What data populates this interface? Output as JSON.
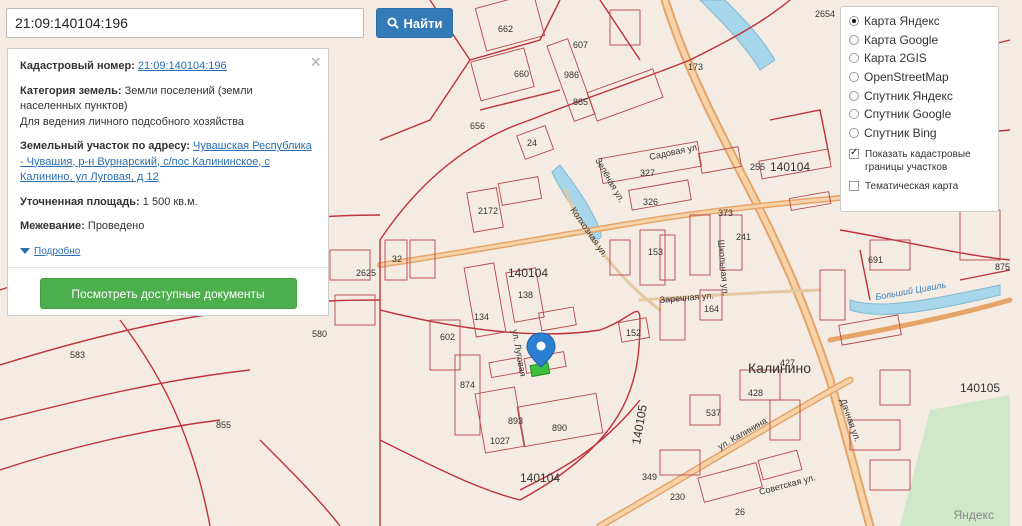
{
  "search": {
    "value": "21:09:140104:196",
    "button_label": "Найти"
  },
  "info": {
    "cadastral_label": "Кадастровый номер:",
    "cadastral_value": "21:09:140104:196",
    "category_label": "Категория земель:",
    "category_value": "Земли поселений (земли населенных пунктов)",
    "category_use": "Для ведения личного подсобного хозяйства",
    "address_label": "Земельный участок по адресу:",
    "address_value": "Чувашская Республика - Чувашия, р-н Вурнарский, с/пос Калининское, с Калинино, ул Луговая, д 12",
    "area_label": "Уточненная площадь:",
    "area_value": "1 500 кв.м.",
    "survey_label": "Межевание:",
    "survey_value": "Проведено",
    "details_label": "Подробно",
    "docs_button": "Посмотреть доступные документы",
    "close_glyph": "×"
  },
  "layers": {
    "options": [
      {
        "label": "Карта Яндекс",
        "selected": true
      },
      {
        "label": "Карта Google",
        "selected": false
      },
      {
        "label": "Карта 2GIS",
        "selected": false
      },
      {
        "label": "OpenStreetMap",
        "selected": false
      },
      {
        "label": "Спутник Яндекс",
        "selected": false
      },
      {
        "label": "Спутник Google",
        "selected": false
      },
      {
        "label": "Спутник Bing",
        "selected": false
      }
    ],
    "show_cadastral": "Показать кадастровые границы участков",
    "show_cadastral_checked": true,
    "thematic": "Тематическая карта",
    "thematic_checked": false
  },
  "map": {
    "village_name": "Калинино",
    "attribution": "Яндекс",
    "quarters": [
      "140104",
      "140104",
      "140104",
      "140105",
      "140105"
    ],
    "streets": [
      "Садовая ул.",
      "Зелёная ул.",
      "Колхозная ул.",
      "Заречная ул.",
      "ул. Луговая",
      "Больший Цивиль",
      "ул. Калинина",
      "Советская ул.",
      "Школьная ул.",
      "Дачная ул."
    ],
    "parcels": [
      "2654",
      "607",
      "662",
      "660",
      "173",
      "986",
      "885",
      "656",
      "24",
      "327",
      "255",
      "326",
      "373",
      "241",
      "691",
      "875",
      "2625",
      "32",
      "2172",
      "138",
      "134",
      "153",
      "164",
      "152",
      "583",
      "580",
      "602",
      "874",
      "893",
      "1027",
      "890",
      "855",
      "537",
      "427",
      "428",
      "349",
      "230",
      "26"
    ],
    "colors": {
      "background": "#f4ece2",
      "boundary": "#c0313b",
      "road": "#e9a56a",
      "water": "#9fd2e8",
      "marker": "#2d7fd1",
      "parcel_fill": "#3fbf3f"
    }
  }
}
